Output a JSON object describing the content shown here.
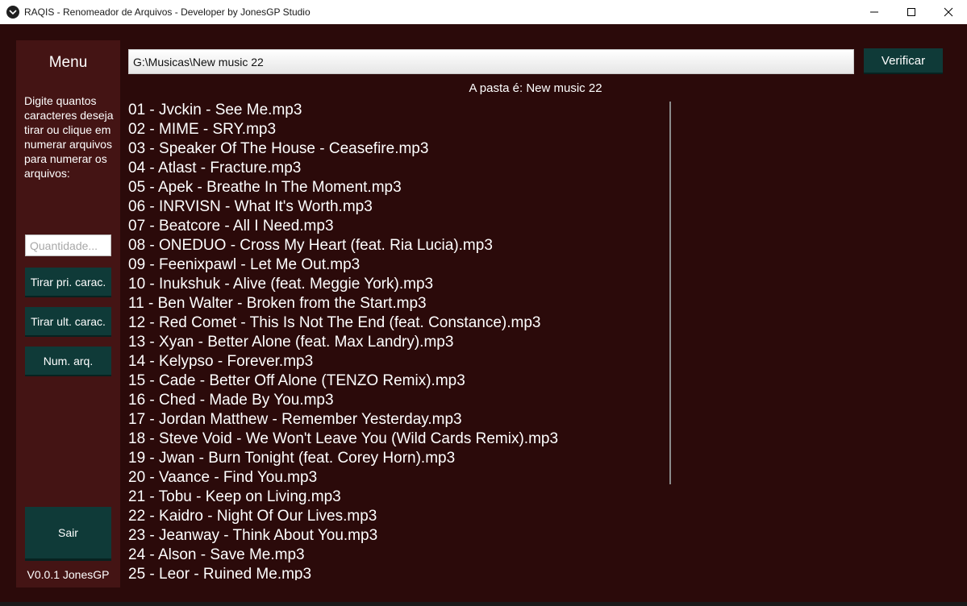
{
  "window": {
    "title": "RAQIS - Renomeador de Arquivos - Developer by JonesGP Studio",
    "icon": "app-logo-icon",
    "controls": [
      "minimize-icon",
      "maximize-icon",
      "close-icon"
    ]
  },
  "sidebar": {
    "title": "Menu",
    "description": "Digite quantos caracteres deseja tirar ou clique em numerar arquivos para numerar os arquivos:",
    "quantity_placeholder": "Quantidade...",
    "remove_first_label": "Tirar pri. carac.",
    "remove_last_label": "Tirar ult. carac.",
    "number_files_label": "Num. arq.",
    "exit_label": "Sair",
    "version": "V0.0.1 JonesGP"
  },
  "path": {
    "value": "G:\\Musicas\\New music 22",
    "verify_label": "Verificar"
  },
  "folder_label": "A pasta é: New music 22",
  "files": [
    "01 - Jvckin - See Me.mp3",
    "02 - MIME - SRY.mp3",
    "03 - Speaker Of The House - Ceasefire.mp3",
    "04 - Atlast - Fracture.mp3",
    "05 - Apek - Breathe In The Moment.mp3",
    "06 - INRVISN - What It's Worth.mp3",
    "07 - Beatcore - All I Need.mp3",
    "08 - ONEDUO - Cross My Heart (feat. Ria Lucia).mp3",
    "09 - Feenixpawl - Let Me Out.mp3",
    "10 - Inukshuk - Alive (feat. Meggie York).mp3",
    "11 - Ben Walter - Broken from the Start.mp3",
    "12 - Red Comet - This Is Not The End (feat. Constance).mp3",
    "13 - Xyan - Better Alone (feat. Max Landry).mp3",
    "14 - Kelypso - Forever.mp3",
    "15 - Cade - Better Off Alone (TENZO Remix).mp3",
    "16 - Ched - Made By You.mp3",
    "17 - Jordan Matthew - Remember Yesterday.mp3",
    "18 - Steve Void - We Won't Leave You (Wild Cards Remix).mp3",
    "19 - Jwan - Burn Tonight (feat. Corey Horn).mp3",
    "20 - Vaance - Find You.mp3",
    "21 - Tobu - Keep on Living.mp3",
    "22 - Kaidro - Night Of Our Lives.mp3",
    "23 - Jeanway - Think About You.mp3",
    "24 - Alson - Save Me.mp3",
    "25 - Leor - Ruined Me.mp3"
  ],
  "colors": {
    "background": "#2b0a0a",
    "sidebar": "#441414",
    "button": "#0f3a38",
    "text": "#ffffff"
  }
}
